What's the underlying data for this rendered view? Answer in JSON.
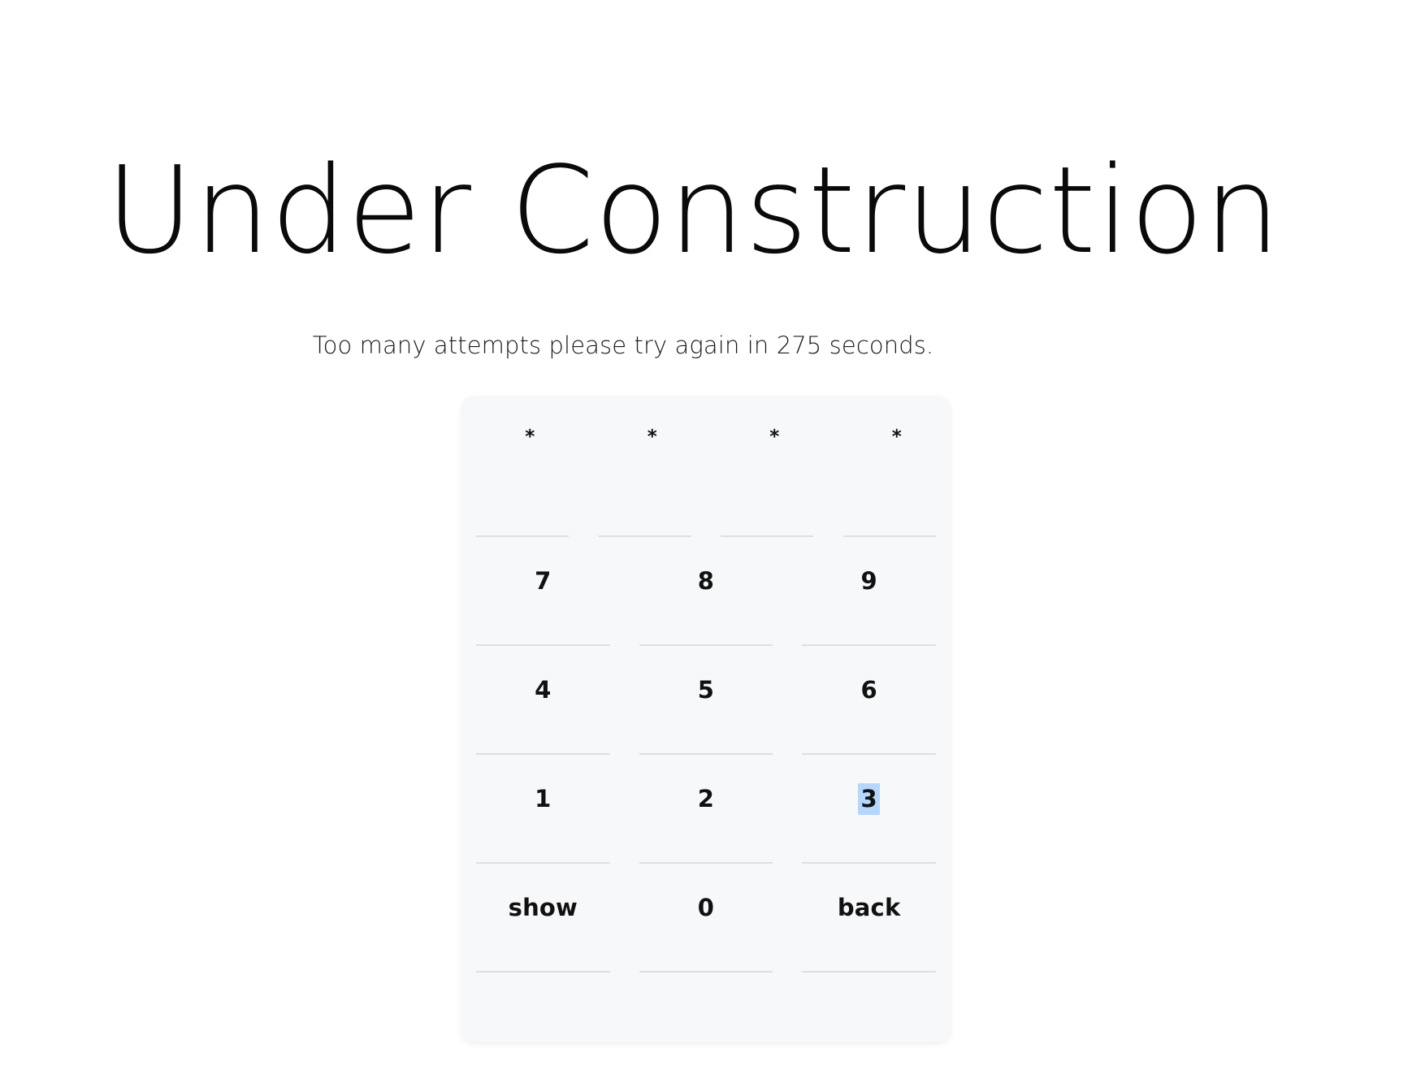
{
  "page": {
    "background_color": "#ffffff",
    "title": "Under Construction"
  },
  "status": {
    "lockout_message": "Too many attempts please try again in 275 seconds.",
    "retry_seconds": 275
  },
  "keypad": {
    "card_background": "#f7f8f9",
    "rule_color": "#dedfe1",
    "selection_highlight_color": "#b5d6fd",
    "display": {
      "mask_character": "*",
      "slots": [
        "*",
        "*",
        "*",
        "*"
      ],
      "entered_length": 4
    },
    "keys": [
      {
        "label": "7",
        "name": "key-7",
        "selected": false
      },
      {
        "label": "8",
        "name": "key-8",
        "selected": false
      },
      {
        "label": "9",
        "name": "key-9",
        "selected": false
      },
      {
        "label": "4",
        "name": "key-4",
        "selected": false
      },
      {
        "label": "5",
        "name": "key-5",
        "selected": false
      },
      {
        "label": "6",
        "name": "key-6",
        "selected": false
      },
      {
        "label": "1",
        "name": "key-1",
        "selected": false
      },
      {
        "label": "2",
        "name": "key-2",
        "selected": false
      },
      {
        "label": "3",
        "name": "key-3",
        "selected": true
      },
      {
        "label": "show",
        "name": "key-show",
        "selected": false
      },
      {
        "label": "0",
        "name": "key-0",
        "selected": false
      },
      {
        "label": "back",
        "name": "key-back",
        "selected": false
      }
    ]
  }
}
